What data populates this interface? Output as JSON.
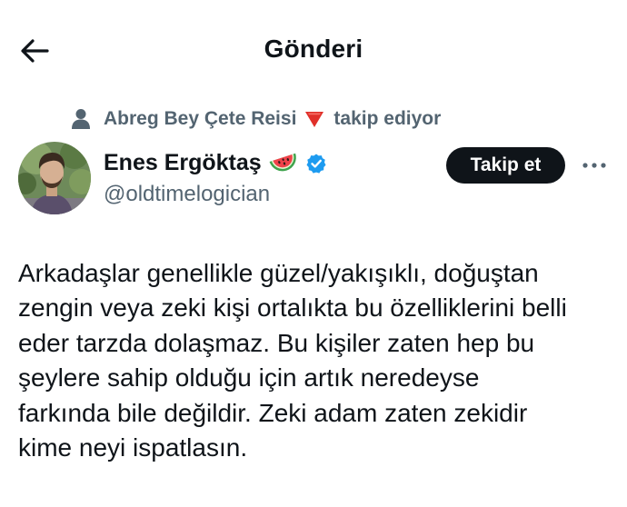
{
  "header": {
    "back_icon": "arrow-left-icon",
    "title": "Gönderi"
  },
  "social_context": {
    "icon": "person-icon",
    "name": "Abreg Bey Çete Reisi",
    "badge_icon": "red-triangle-icon",
    "badge_color": "#e0302a",
    "action": "takip ediyor"
  },
  "author": {
    "avatar_icon": "avatar",
    "name": "Enes Ergöktaş",
    "name_emoji": "watermelon-icon",
    "verified_icon": "verified-badge-icon",
    "verified_color": "#1d9bf0",
    "handle": "@oldtimelogician"
  },
  "actions": {
    "follow_label": "Takip et",
    "more_icon": "more-horizontal-icon"
  },
  "tweet": {
    "lines": [
      "Arkadaşlar genellikle güzel/yakışıklı, doğuştan",
      "zengin veya zeki kişi ortalıkta bu özelliklerini belli",
      "eder tarzda dolaşmaz. Bu kişiler zaten hep bu",
      "şeylere sahip olduğu için artık neredeyse",
      "farkında bile değildir. Zeki adam zaten zekidir",
      "kime neyi ispatlasın."
    ]
  },
  "colors": {
    "text_primary": "#0f1419",
    "text_secondary": "#536471",
    "button_bg": "#0f1419"
  }
}
